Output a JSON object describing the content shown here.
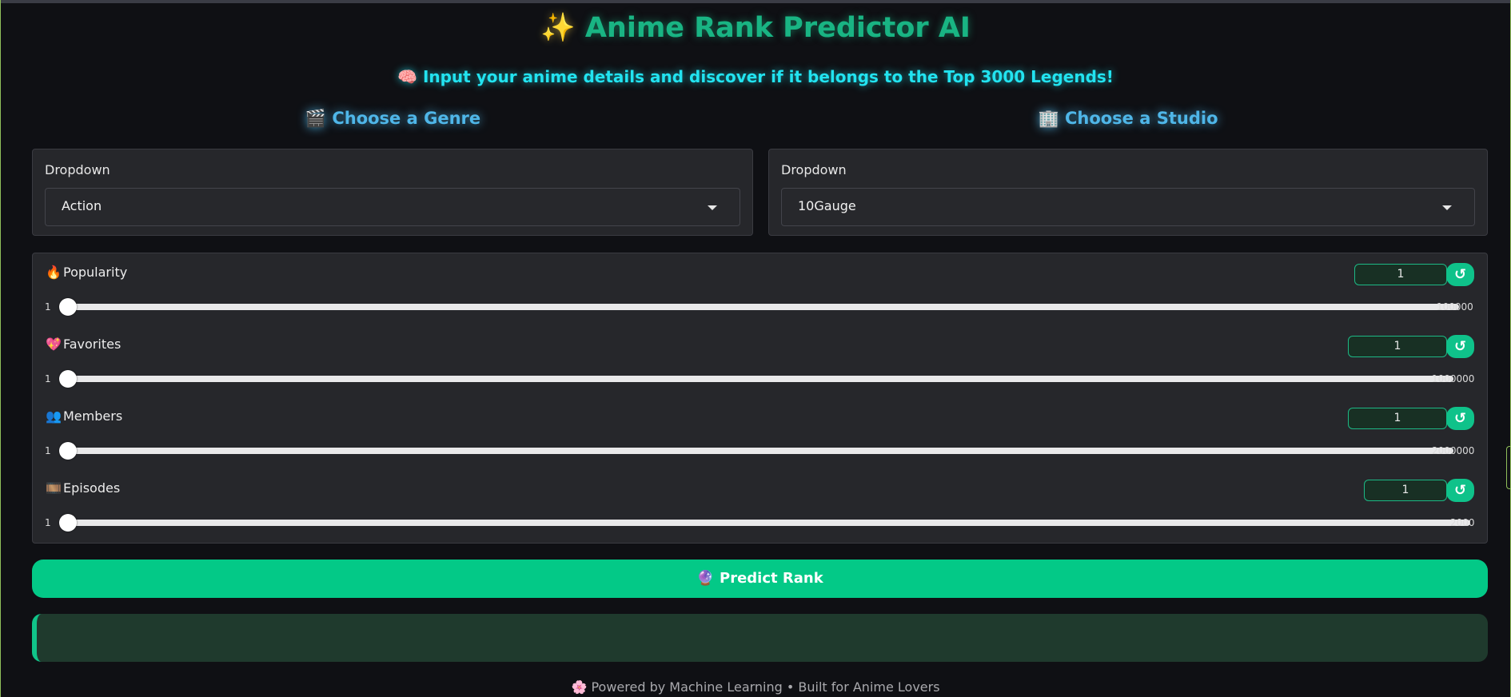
{
  "header": {
    "title_icon": "✨",
    "title": "Anime Rank Predictor AI",
    "subtitle_icon": "🧠",
    "subtitle": "Input your anime details and discover if it belongs to the Top 3000 Legends!"
  },
  "genre": {
    "heading_icon": "🎬",
    "heading": "Choose a Genre",
    "dropdown_label": "Dropdown",
    "selected": "Action"
  },
  "studio": {
    "heading_icon": "🏢",
    "heading": "Choose a Studio",
    "dropdown_label": "Dropdown",
    "selected": "10Gauge"
  },
  "sliders": [
    {
      "icon": "🔥",
      "label": "Popularity",
      "value": "1",
      "min": "1",
      "max": "100000",
      "reset": "↺"
    },
    {
      "icon": "💖",
      "label": "Favorites",
      "value": "1",
      "min": "1",
      "max": "1000000",
      "reset": "↺"
    },
    {
      "icon": "👥",
      "label": "Members",
      "value": "1",
      "min": "1",
      "max": "2000000",
      "reset": "↺"
    },
    {
      "icon": "🎞️",
      "label": "Episodes",
      "value": "1",
      "min": "1",
      "max": "2000",
      "reset": "↺"
    }
  ],
  "predict": {
    "icon": "🔮",
    "label": "Predict Rank"
  },
  "output": {
    "text": ""
  },
  "footer": {
    "icon": "🌸",
    "text": "Powered by Machine Learning • Built for Anime Lovers"
  },
  "colors": {
    "accent": "#03c987",
    "title": "#19b483",
    "subtitle": "#22e3f0",
    "section_heading": "#4fb6e8",
    "background": "#0f1014",
    "card": "#26272b",
    "output_bg": "#1f3a2d"
  }
}
